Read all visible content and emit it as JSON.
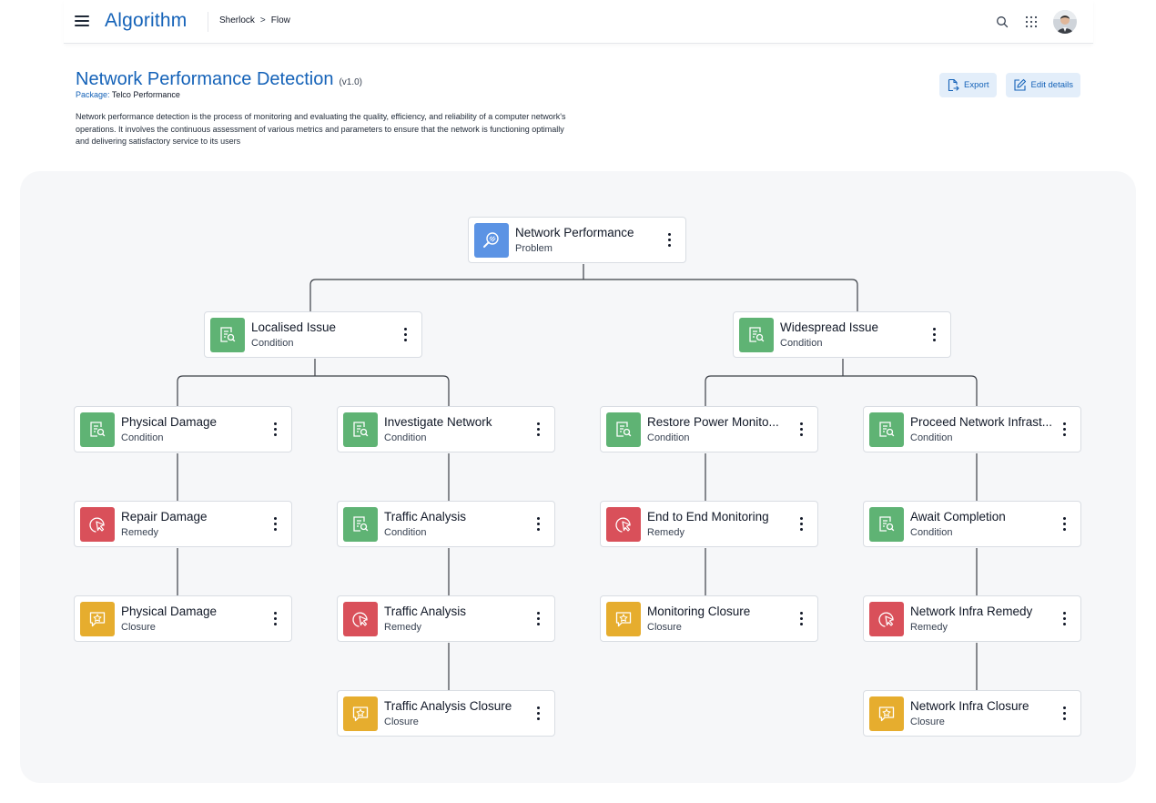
{
  "app": {
    "brand": "Algorithm"
  },
  "breadcrumb": {
    "items": [
      "Sherlock",
      "Flow"
    ],
    "separator": ">"
  },
  "header": {
    "title": "Network Performance Detection",
    "version": "(v1.0)",
    "package_label": "Package:",
    "package_value": "Telco Performance",
    "description": "Network performance detection is the process of monitoring and evaluating the quality, efficiency, and reliability of a computer network's operations. It involves the continuous assessment of various metrics and parameters to ensure that the network is functioning optimally and delivering satisfactory service to its users"
  },
  "actions": {
    "export_label": "Export",
    "edit_label": "Edit details"
  },
  "colors": {
    "brand": "#1462b8",
    "condition": "#5fb374",
    "remedy": "#d9505a",
    "closure": "#e6ad2e",
    "problem": "#5b93e4"
  },
  "nodes": [
    {
      "title": "Network Performance",
      "type": "Problem",
      "icon": "problem-search-icon"
    },
    {
      "title": "Localised Issue",
      "type": "Condition",
      "icon": "condition-icon"
    },
    {
      "title": "Widespread Issue",
      "type": "Condition",
      "icon": "condition-icon"
    },
    {
      "title": "Physical Damage",
      "type": "Condition",
      "icon": "condition-icon"
    },
    {
      "title": "Investigate Network",
      "type": "Condition",
      "icon": "condition-icon"
    },
    {
      "title": "Restore Power Monito...",
      "type": "Condition",
      "icon": "condition-icon"
    },
    {
      "title": "Proceed Network Infrast...",
      "type": "Condition",
      "icon": "condition-icon"
    },
    {
      "title": "Repair Damage",
      "type": "Remedy",
      "icon": "remedy-icon"
    },
    {
      "title": "Traffic Analysis",
      "type": "Condition",
      "icon": "condition-icon"
    },
    {
      "title": "End to End Monitoring",
      "type": "Remedy",
      "icon": "remedy-icon"
    },
    {
      "title": "Await Completion",
      "type": "Condition",
      "icon": "condition-icon"
    },
    {
      "title": "Physical Damage",
      "type": "Closure",
      "icon": "closure-icon"
    },
    {
      "title": "Traffic Analysis",
      "type": "Remedy",
      "icon": "remedy-icon"
    },
    {
      "title": "Monitoring Closure",
      "type": "Closure",
      "icon": "closure-icon"
    },
    {
      "title": "Network Infra Remedy",
      "type": "Remedy",
      "icon": "remedy-icon"
    },
    {
      "title": "Traffic Analysis Closure",
      "type": "Closure",
      "icon": "closure-icon"
    },
    {
      "title": "Network Infra Closure",
      "type": "Closure",
      "icon": "closure-icon"
    }
  ]
}
